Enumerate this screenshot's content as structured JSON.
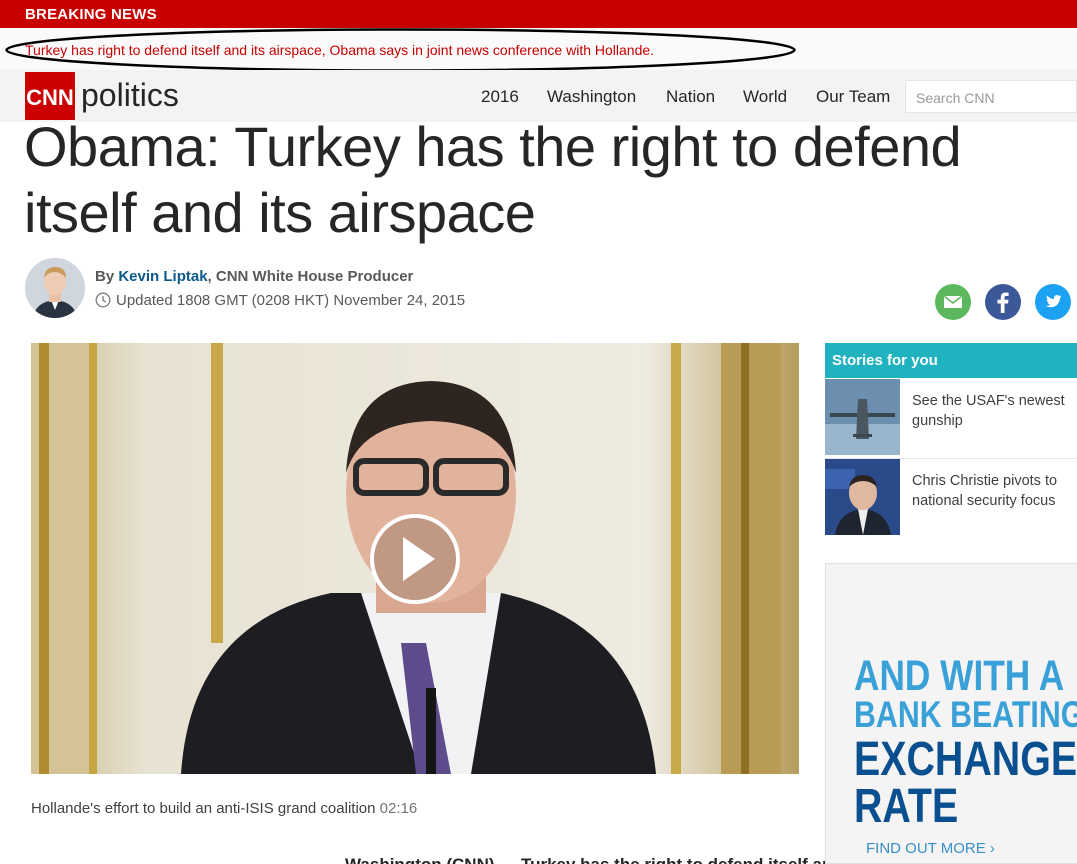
{
  "breaking": {
    "label": "BREAKING NEWS",
    "text": "Turkey has right to defend itself and its airspace, Obama says in joint news conference with Hollande."
  },
  "nav": {
    "logo_cnn": "CNN",
    "logo_section": "politics",
    "items": [
      "2016",
      "Washington",
      "Nation",
      "World",
      "Our Team"
    ],
    "search_placeholder": "Search CNN"
  },
  "article": {
    "headline": "Obama: Turkey has the right to defend itself and its airspace",
    "byline_prefix": "By ",
    "author": "Kevin Liptak",
    "author_title": ", CNN White House Producer",
    "updated": "Updated 1808 GMT (0208 HKT) November 24, 2015",
    "video_caption": "Hollande's effort to build an anti-ISIS grand coalition",
    "video_duration": "02:16",
    "body_start": "Washington (CNN) — Turkey has the right to defend itself and its airspace"
  },
  "sidebar": {
    "title": "Stories for you",
    "stories": [
      {
        "text": "See the USAF's newest gunship"
      },
      {
        "text": "Chris Christie pivots to national security focus"
      }
    ]
  },
  "ad": {
    "line1": "AND WITH A",
    "line2": "BANK BEATING",
    "line3": "EXCHANGE",
    "line4": "RATE",
    "cta": "FIND OUT MORE"
  },
  "colors": {
    "breaking_red": "#c70000",
    "stories_teal": "#20b3bf",
    "author_blue": "#0c5a8c",
    "email_green": "#5cb85c",
    "facebook_blue": "#3b5998",
    "twitter_blue": "#1da1f2"
  },
  "icons": [
    "clock-icon",
    "email-icon",
    "facebook-icon",
    "twitter-icon",
    "play-icon"
  ]
}
